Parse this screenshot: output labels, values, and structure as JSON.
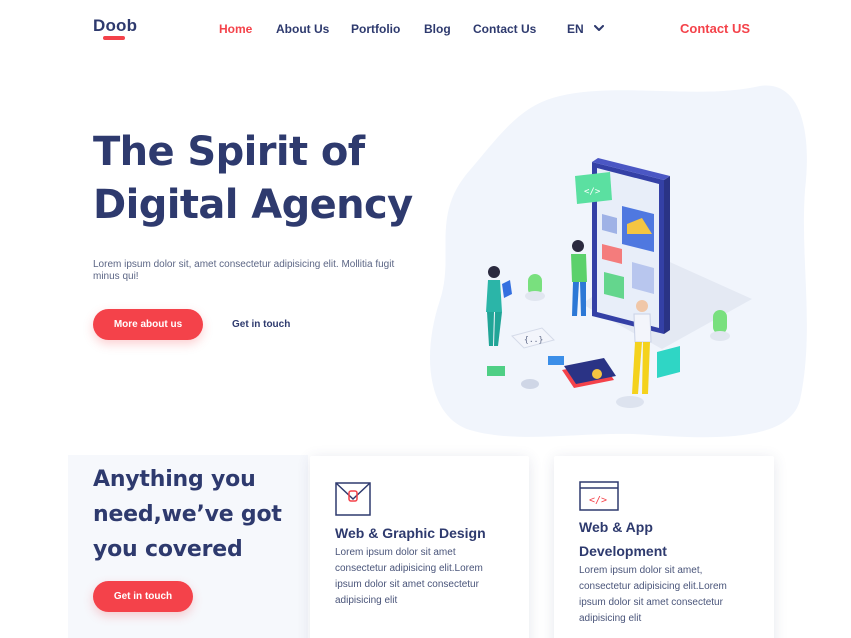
{
  "brand": {
    "logo": "Doob",
    "accent": "#f4424a",
    "primary": "#2e3a6e"
  },
  "nav": {
    "items": [
      {
        "label": "Home",
        "active": true
      },
      {
        "label": "About Us",
        "active": false
      },
      {
        "label": "Portfolio",
        "active": false
      },
      {
        "label": "Blog",
        "active": false
      },
      {
        "label": "Contact Us",
        "active": false
      }
    ],
    "language": "EN",
    "cta": "Contact US"
  },
  "hero": {
    "title_line1": "The Spirit of",
    "title_line2": "Digital Agency",
    "text": "Lorem ipsum dolor sit, amet consectetur adipisicing elit. Mollitia fugit minus qui!",
    "primary_button": "More about us",
    "secondary_link": "Get in touch",
    "illustration_icon": "isometric-app-team-illustration"
  },
  "services": {
    "title_line1": "Anything you",
    "title_line2": "need,we’ve got",
    "title_line3": "you covered",
    "button": "Get in touch",
    "cards": [
      {
        "icon": "envelope-icon",
        "title": "Web & Graphic Design",
        "text": "Lorem ipsum dolor sit amet consectetur adipisicing elit.Lorem ipsum dolor sit amet consectetur adipisicing elit"
      },
      {
        "icon": "code-window-icon",
        "title_line1": "Web & App",
        "title_line2": "Development",
        "text": "Lorem ipsum dolor sit amet, consectetur adipisicing elit.Lorem ipsum dolor sit amet consectetur adipisicing elit"
      }
    ]
  }
}
